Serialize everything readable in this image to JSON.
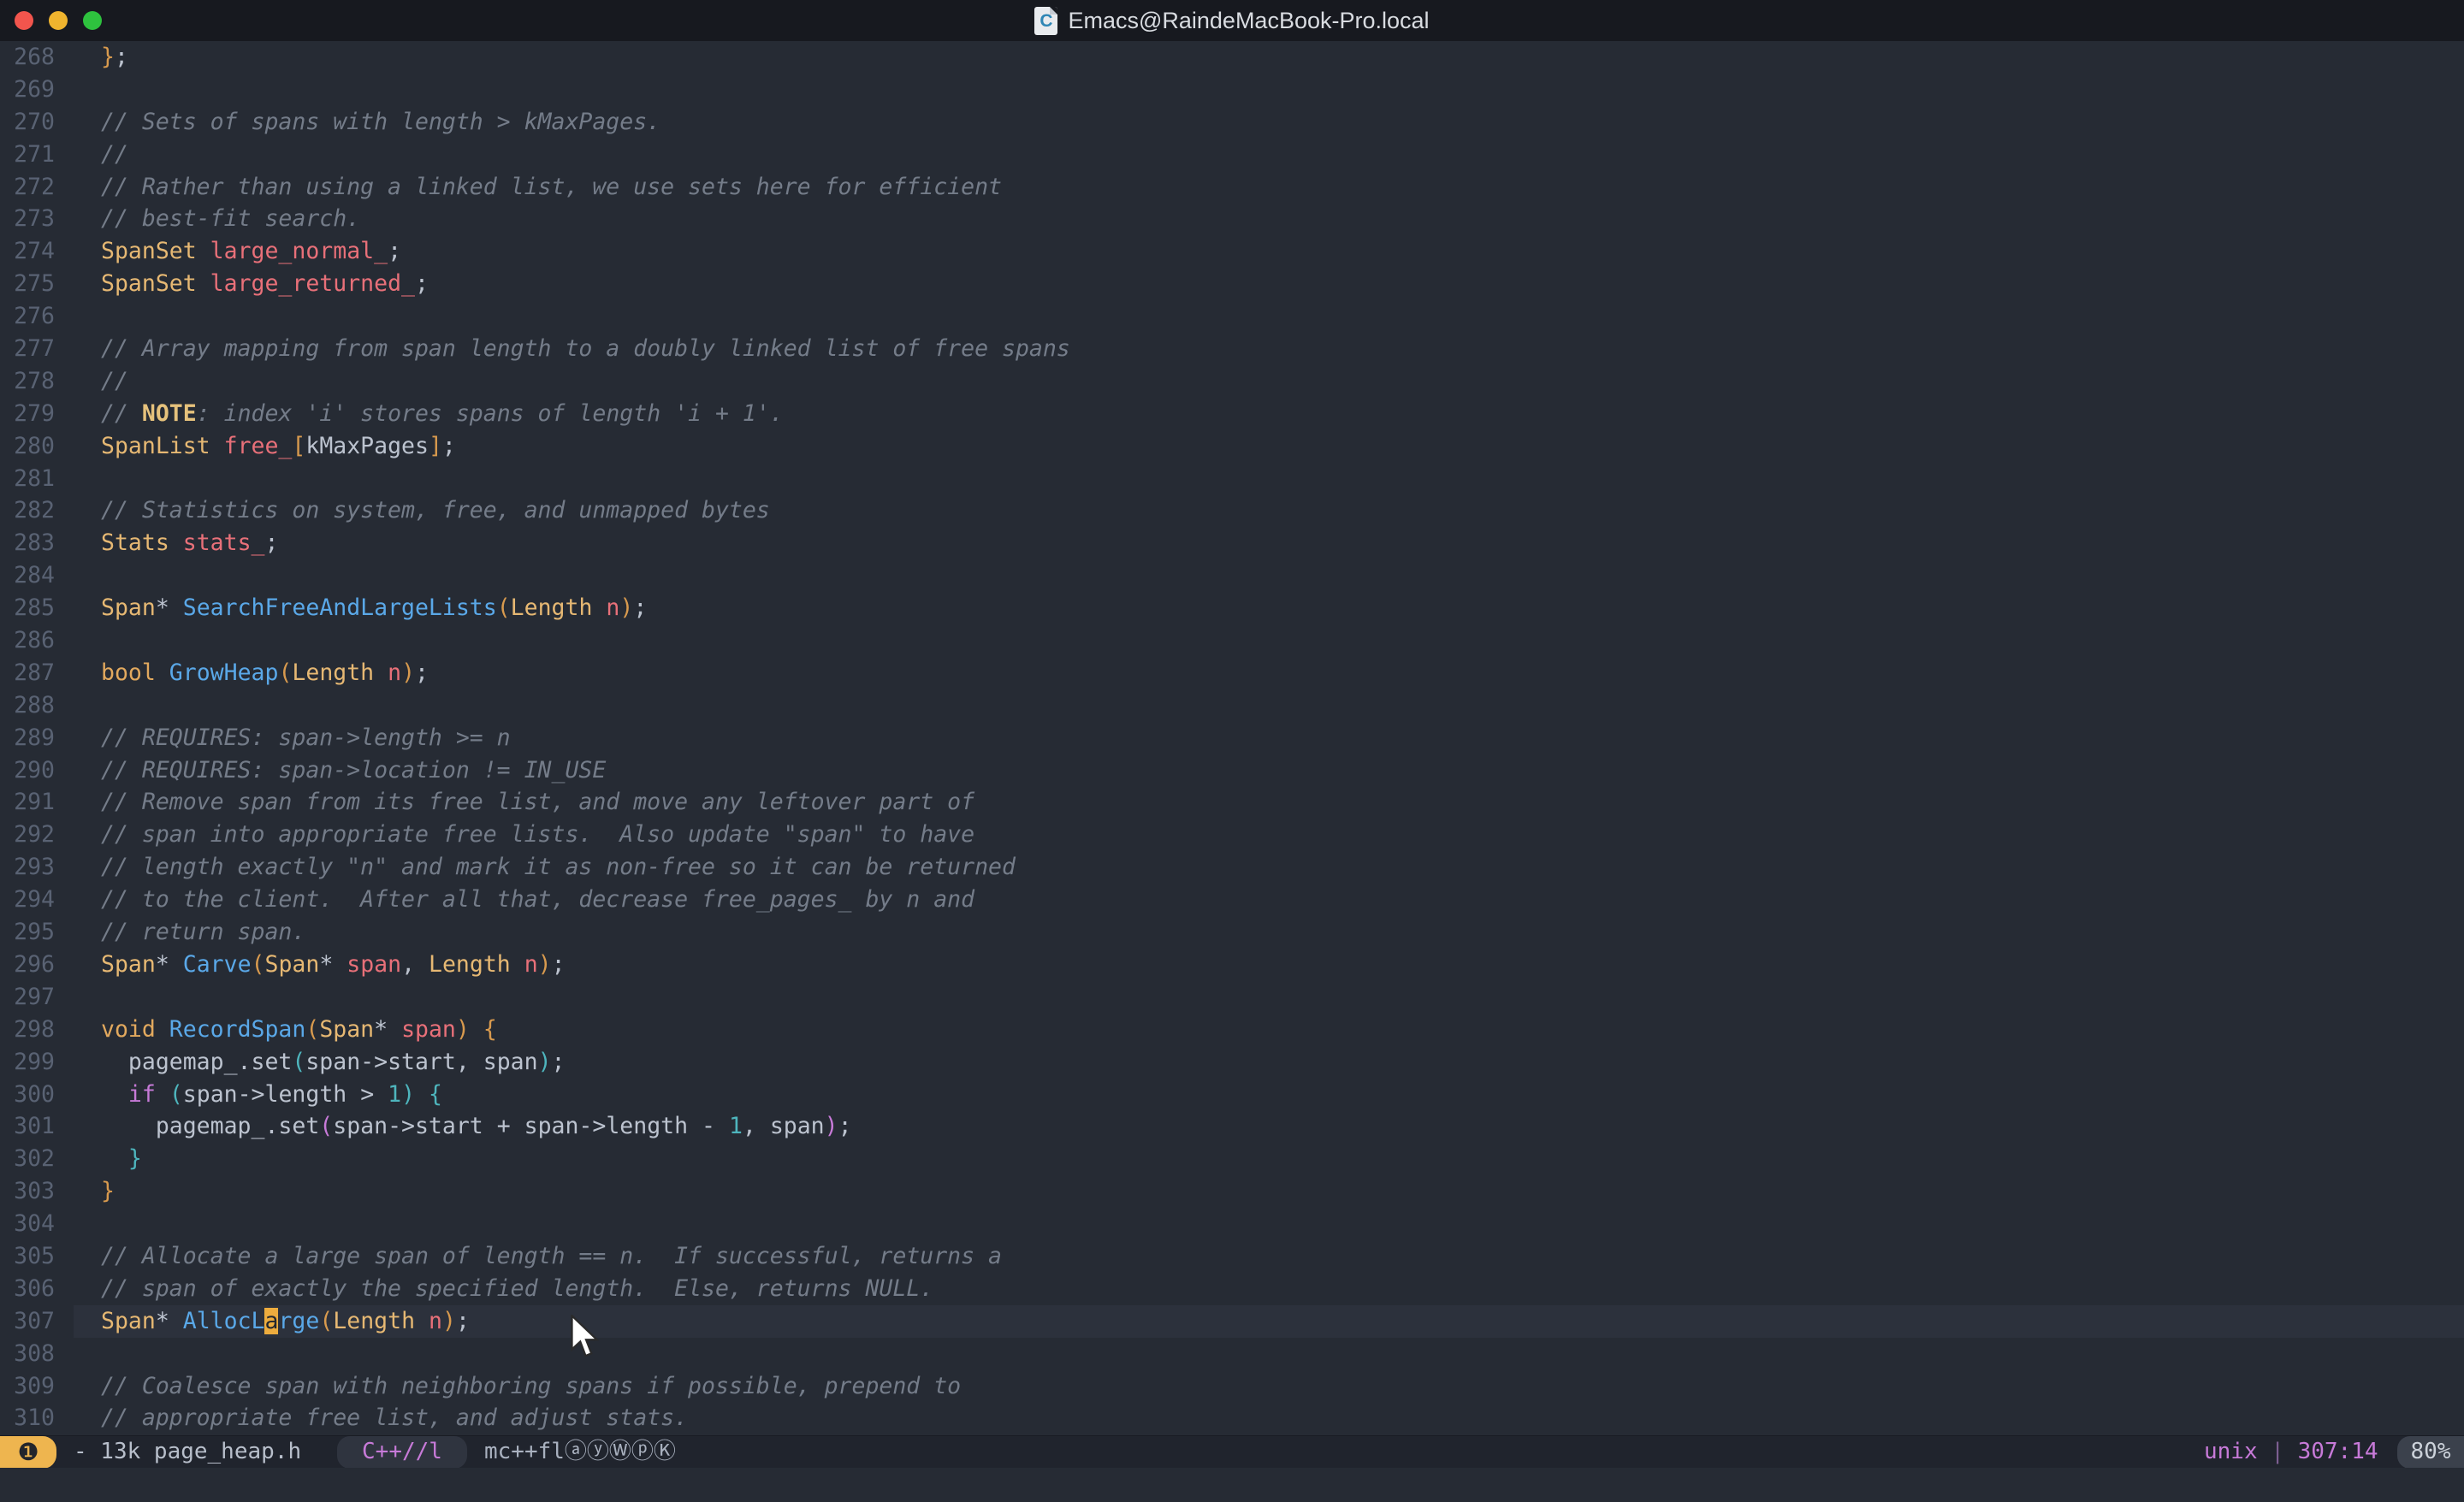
{
  "window": {
    "title": "Emacs@RaindeMacBook-Pro.local",
    "doc_icon_letter": "C"
  },
  "colors": {
    "background": "#262b34",
    "titlebar": "#17191f",
    "modeline": "#20242d",
    "accent_gold": "#e6b873",
    "function_blue": "#5aa8e8",
    "variable_red": "#e87079",
    "magenta": "#c77ad8",
    "teal": "#4eb5bd",
    "comment_gray": "#747c89",
    "cursor": "#edac3e"
  },
  "editor": {
    "lines": [
      {
        "n": "268",
        "tok": [
          [
            "}",
            "o"
          ],
          [
            ";",
            "w"
          ]
        ]
      },
      {
        "n": "269",
        "tok": []
      },
      {
        "n": "270",
        "tok": [
          [
            "// Sets of spans with length > kMaxPages.",
            "c"
          ]
        ]
      },
      {
        "n": "271",
        "tok": [
          [
            "//",
            "c"
          ]
        ]
      },
      {
        "n": "272",
        "tok": [
          [
            "// Rather than using a linked list, we use sets here for efficient",
            "c"
          ]
        ]
      },
      {
        "n": "273",
        "tok": [
          [
            "// best-fit search.",
            "c"
          ]
        ]
      },
      {
        "n": "274",
        "tok": [
          [
            "SpanSet",
            "y"
          ],
          [
            " ",
            "w"
          ],
          [
            "large_normal_",
            "r"
          ],
          [
            ";",
            "w"
          ]
        ]
      },
      {
        "n": "275",
        "tok": [
          [
            "SpanSet",
            "y"
          ],
          [
            " ",
            "w"
          ],
          [
            "large_returned_",
            "r"
          ],
          [
            ";",
            "w"
          ]
        ]
      },
      {
        "n": "276",
        "tok": []
      },
      {
        "n": "277",
        "tok": [
          [
            "// Array mapping from span length to a doubly linked list of free spans",
            "c"
          ]
        ]
      },
      {
        "n": "278",
        "tok": [
          [
            "//",
            "c"
          ]
        ]
      },
      {
        "n": "279",
        "tok": [
          [
            "// ",
            "c"
          ],
          [
            "NOTE",
            "nt"
          ],
          [
            ": index 'i' stores spans of length 'i + 1'.",
            "c"
          ]
        ]
      },
      {
        "n": "280",
        "tok": [
          [
            "SpanList",
            "y"
          ],
          [
            " ",
            "w"
          ],
          [
            "free_",
            "r"
          ],
          [
            "[",
            "o"
          ],
          [
            "kMaxPages",
            "w"
          ],
          [
            "]",
            "o"
          ],
          [
            ";",
            "w"
          ]
        ]
      },
      {
        "n": "281",
        "tok": []
      },
      {
        "n": "282",
        "tok": [
          [
            "// Statistics on system, free, and unmapped bytes",
            "c"
          ]
        ]
      },
      {
        "n": "283",
        "tok": [
          [
            "Stats",
            "y"
          ],
          [
            " ",
            "w"
          ],
          [
            "stats_",
            "r"
          ],
          [
            ";",
            "w"
          ]
        ]
      },
      {
        "n": "284",
        "tok": []
      },
      {
        "n": "285",
        "tok": [
          [
            "Span",
            "y"
          ],
          [
            "* ",
            "w"
          ],
          [
            "SearchFreeAndLargeLists",
            "b"
          ],
          [
            "(",
            "o"
          ],
          [
            "Length",
            "y"
          ],
          [
            " ",
            "w"
          ],
          [
            "n",
            "r"
          ],
          [
            ")",
            "o"
          ],
          [
            ";",
            "w"
          ]
        ]
      },
      {
        "n": "286",
        "tok": []
      },
      {
        "n": "287",
        "tok": [
          [
            "bool",
            "k"
          ],
          [
            " ",
            "w"
          ],
          [
            "GrowHeap",
            "b"
          ],
          [
            "(",
            "o"
          ],
          [
            "Length",
            "y"
          ],
          [
            " ",
            "w"
          ],
          [
            "n",
            "r"
          ],
          [
            ")",
            "o"
          ],
          [
            ";",
            "w"
          ]
        ]
      },
      {
        "n": "288",
        "tok": []
      },
      {
        "n": "289",
        "tok": [
          [
            "// REQUIRES: span->length >= n",
            "c"
          ]
        ]
      },
      {
        "n": "290",
        "tok": [
          [
            "// REQUIRES: span->location != IN_USE",
            "c"
          ]
        ]
      },
      {
        "n": "291",
        "tok": [
          [
            "// Remove span from its free list, and move any leftover part of",
            "c"
          ]
        ]
      },
      {
        "n": "292",
        "tok": [
          [
            "// span into appropriate free lists.  Also update \"span\" to have",
            "c"
          ]
        ]
      },
      {
        "n": "293",
        "tok": [
          [
            "// length exactly \"n\" and mark it as non-free so it can be returned",
            "c"
          ]
        ]
      },
      {
        "n": "294",
        "tok": [
          [
            "// to the client.  After all that, decrease free_pages_ by n and",
            "c"
          ]
        ]
      },
      {
        "n": "295",
        "tok": [
          [
            "// return span.",
            "c"
          ]
        ]
      },
      {
        "n": "296",
        "tok": [
          [
            "Span",
            "y"
          ],
          [
            "* ",
            "w"
          ],
          [
            "Carve",
            "b"
          ],
          [
            "(",
            "o"
          ],
          [
            "Span",
            "y"
          ],
          [
            "* ",
            "w"
          ],
          [
            "span",
            "r"
          ],
          [
            ", ",
            "w"
          ],
          [
            "Length",
            "y"
          ],
          [
            " ",
            "w"
          ],
          [
            "n",
            "r"
          ],
          [
            ")",
            "o"
          ],
          [
            ";",
            "w"
          ]
        ]
      },
      {
        "n": "297",
        "tok": []
      },
      {
        "n": "298",
        "tok": [
          [
            "void",
            "k"
          ],
          [
            " ",
            "w"
          ],
          [
            "RecordSpan",
            "b"
          ],
          [
            "(",
            "o"
          ],
          [
            "Span",
            "y"
          ],
          [
            "* ",
            "w"
          ],
          [
            "span",
            "r"
          ],
          [
            ")",
            "o"
          ],
          [
            " ",
            "w"
          ],
          [
            "{",
            "o"
          ]
        ]
      },
      {
        "n": "299",
        "tok": [
          [
            "  pagemap_.set",
            "w"
          ],
          [
            "(",
            "t"
          ],
          [
            "span->start, span",
            "w"
          ],
          [
            ")",
            "t"
          ],
          [
            ";",
            "w"
          ]
        ]
      },
      {
        "n": "300",
        "tok": [
          [
            "  ",
            "w"
          ],
          [
            "if",
            "m"
          ],
          [
            " ",
            "w"
          ],
          [
            "(",
            "t"
          ],
          [
            "span->length > ",
            "w"
          ],
          [
            "1",
            "t"
          ],
          [
            ")",
            "t"
          ],
          [
            " ",
            "w"
          ],
          [
            "{",
            "t"
          ]
        ]
      },
      {
        "n": "301",
        "tok": [
          [
            "    pagemap_.set",
            "w"
          ],
          [
            "(",
            "m"
          ],
          [
            "span->start + span->length - ",
            "w"
          ],
          [
            "1",
            "t"
          ],
          [
            ", span",
            "w"
          ],
          [
            ")",
            "m"
          ],
          [
            ";",
            "w"
          ]
        ]
      },
      {
        "n": "302",
        "tok": [
          [
            "  ",
            "w"
          ],
          [
            "}",
            "t"
          ]
        ]
      },
      {
        "n": "303",
        "tok": [
          [
            "}",
            "o"
          ]
        ]
      },
      {
        "n": "304",
        "tok": []
      },
      {
        "n": "305",
        "tok": [
          [
            "// Allocate a large span of length == n.  If successful, returns a",
            "c"
          ]
        ]
      },
      {
        "n": "306",
        "tok": [
          [
            "// span of exactly the specified length.  Else, returns NULL.",
            "c"
          ]
        ]
      },
      {
        "n": "307",
        "hl": true,
        "tok": [
          [
            "Span",
            "y"
          ],
          [
            "* ",
            "w"
          ],
          [
            "AllocL",
            "b"
          ],
          [
            "a",
            "cur"
          ],
          [
            "rge",
            "b"
          ],
          [
            "(",
            "o"
          ],
          [
            "Length",
            "y"
          ],
          [
            " ",
            "w"
          ],
          [
            "n",
            "r"
          ],
          [
            ")",
            "o"
          ],
          [
            ";",
            "w"
          ]
        ]
      },
      {
        "n": "308",
        "tok": []
      },
      {
        "n": "309",
        "tok": [
          [
            "// Coalesce span with neighboring spans if possible, prepend to",
            "c"
          ]
        ]
      },
      {
        "n": "310",
        "tok": [
          [
            "// appropriate free list, and adjust stats.",
            "c"
          ]
        ]
      }
    ]
  },
  "modeline": {
    "window_number": "❶",
    "buffer_info": "- 13k page_heap.h",
    "major_mode": "C++//l",
    "minor_modes": "mc++flⓐⓨⓌⓟⓀ",
    "encoding": "unix",
    "separator": "|",
    "position": "307:14",
    "percent": "80%"
  }
}
